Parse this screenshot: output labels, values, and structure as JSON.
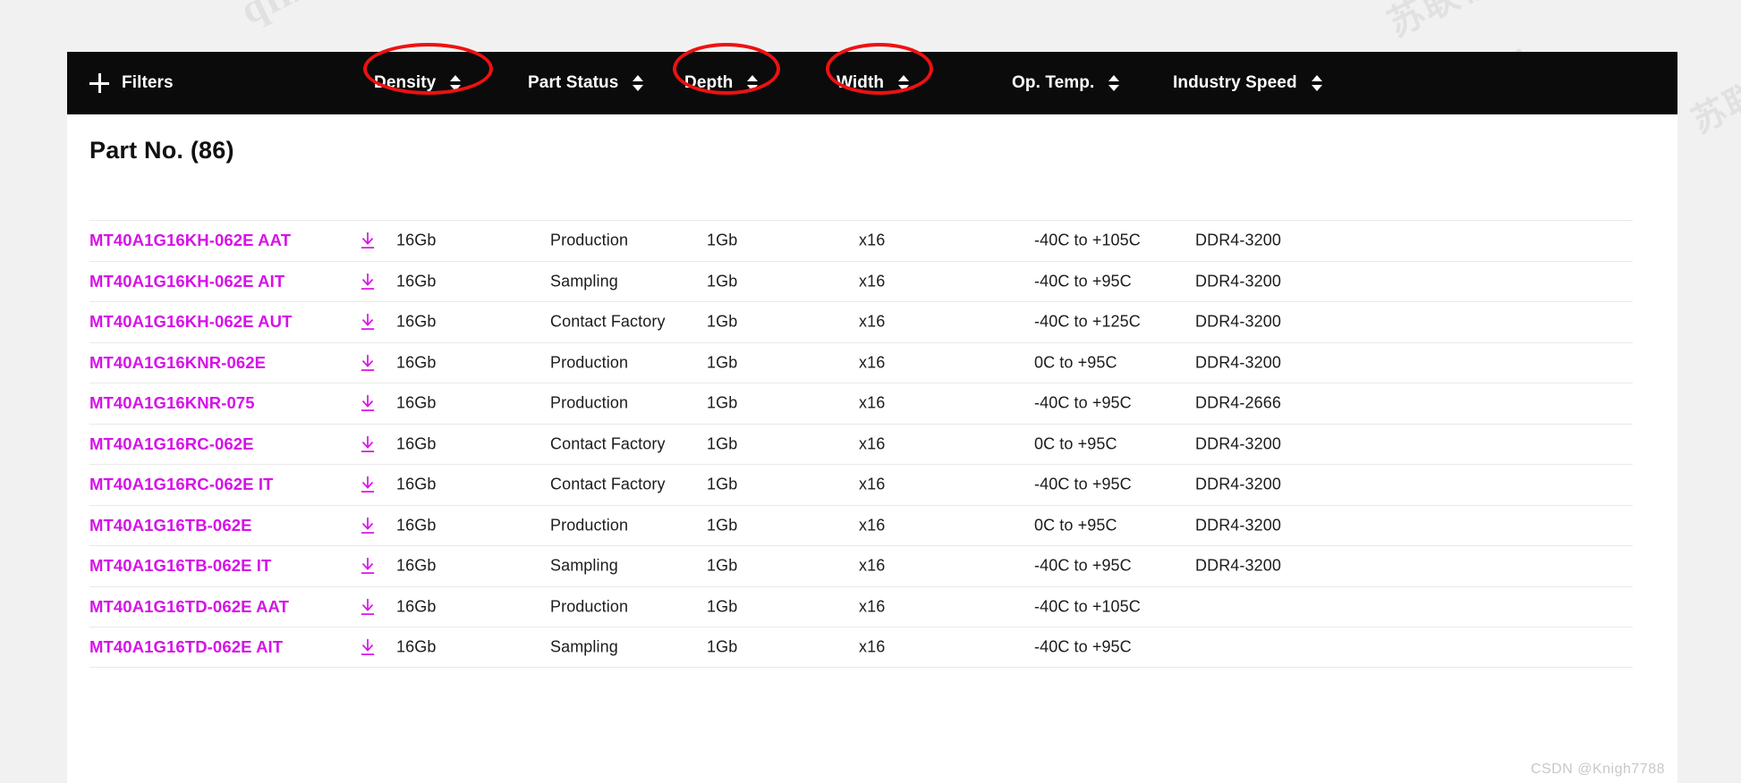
{
  "header": {
    "filters_label": "Filters",
    "plus_icon": "plus-icon",
    "columns": [
      {
        "label": "Density",
        "sort_icon": "sort-updown-icon",
        "highlighted": true
      },
      {
        "label": "Part Status",
        "sort_icon": "sort-updown-icon",
        "highlighted": false
      },
      {
        "label": "Depth",
        "sort_icon": "sort-updown-icon",
        "highlighted": true
      },
      {
        "label": "Width",
        "sort_icon": "sort-updown-icon",
        "highlighted": true
      },
      {
        "label": "Op. Temp.",
        "sort_icon": "sort-updown-icon",
        "highlighted": false
      },
      {
        "label": "Industry Speed",
        "sort_icon": "sort-updown-icon",
        "highlighted": false
      }
    ]
  },
  "main": {
    "title": "Part No. (86)",
    "result_count": 86,
    "download_icon": "download-icon",
    "rows": [
      {
        "part_no": "MT40A1G16KH-062E AAT",
        "density": "16Gb",
        "part_status": "Production",
        "depth": "1Gb",
        "width": "x16",
        "op_temp": "-40C to +105C",
        "industry_speed": "DDR4-3200"
      },
      {
        "part_no": "MT40A1G16KH-062E AIT",
        "density": "16Gb",
        "part_status": "Sampling",
        "depth": "1Gb",
        "width": "x16",
        "op_temp": "-40C to +95C",
        "industry_speed": "DDR4-3200"
      },
      {
        "part_no": "MT40A1G16KH-062E AUT",
        "density": "16Gb",
        "part_status": "Contact Factory",
        "depth": "1Gb",
        "width": "x16",
        "op_temp": "-40C to +125C",
        "industry_speed": "DDR4-3200"
      },
      {
        "part_no": "MT40A1G16KNR-062E",
        "density": "16Gb",
        "part_status": "Production",
        "depth": "1Gb",
        "width": "x16",
        "op_temp": "0C to +95C",
        "industry_speed": "DDR4-3200"
      },
      {
        "part_no": "MT40A1G16KNR-075",
        "density": "16Gb",
        "part_status": "Production",
        "depth": "1Gb",
        "width": "x16",
        "op_temp": "-40C to +95C",
        "industry_speed": "DDR4-2666"
      },
      {
        "part_no": "MT40A1G16RC-062E",
        "density": "16Gb",
        "part_status": "Contact Factory",
        "depth": "1Gb",
        "width": "x16",
        "op_temp": "0C to +95C",
        "industry_speed": "DDR4-3200"
      },
      {
        "part_no": "MT40A1G16RC-062E IT",
        "density": "16Gb",
        "part_status": "Contact Factory",
        "depth": "1Gb",
        "width": "x16",
        "op_temp": "-40C to +95C",
        "industry_speed": "DDR4-3200"
      },
      {
        "part_no": "MT40A1G16TB-062E",
        "density": "16Gb",
        "part_status": "Production",
        "depth": "1Gb",
        "width": "x16",
        "op_temp": "0C to +95C",
        "industry_speed": "DDR4-3200"
      },
      {
        "part_no": "MT40A1G16TB-062E IT",
        "density": "16Gb",
        "part_status": "Sampling",
        "depth": "1Gb",
        "width": "x16",
        "op_temp": "-40C to +95C",
        "industry_speed": "DDR4-3200"
      },
      {
        "part_no": "MT40A1G16TD-062E AAT",
        "density": "16Gb",
        "part_status": "Production",
        "depth": "1Gb",
        "width": "x16",
        "op_temp": "-40C to +105C",
        "industry_speed": ""
      },
      {
        "part_no": "MT40A1G16TD-062E AIT",
        "density": "16Gb",
        "part_status": "Sampling",
        "depth": "1Gb",
        "width": "x16",
        "op_temp": "-40C to +95C",
        "industry_speed": ""
      }
    ]
  },
  "annotations": {
    "ellipse_color": "#ee1111",
    "ellipses": [
      {
        "target": "Density"
      },
      {
        "target": "Depth"
      },
      {
        "target": "Width"
      }
    ]
  },
  "watermarks": {
    "credit": "CSDN @Knigh7788",
    "tiles": [
      "qiming.dai",
      "苏联视"
    ]
  },
  "colors": {
    "header_bg": "#0b0b0b",
    "panel_bg": "#ffffff",
    "page_bg": "#f1f1f1",
    "link": "#d612e8",
    "annotation": "#ee1111"
  }
}
